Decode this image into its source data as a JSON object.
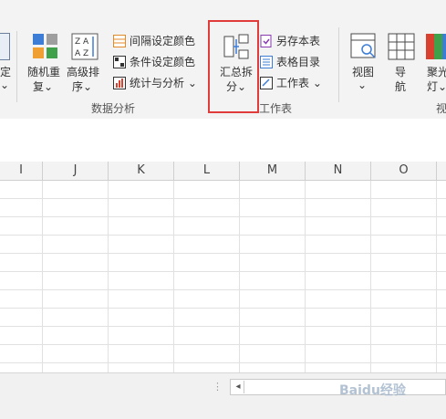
{
  "ribbon": {
    "left_clip": {
      "line1": "定",
      "line2": "⌄"
    },
    "random_btn": {
      "line1": "随机重",
      "line2": "复⌄"
    },
    "sort_btn": {
      "line1": "高级排",
      "line2": "序⌄"
    },
    "list": [
      {
        "label": "间隔设定颜色"
      },
      {
        "label": "条件设定颜色"
      },
      {
        "label": "统计与分析 ⌄"
      }
    ],
    "group_data_analysis": "数据分析",
    "summary_split": {
      "line1": "汇总拆",
      "line2": "分⌄"
    },
    "worksheet_list": [
      {
        "label": "另存本表"
      },
      {
        "label": "表格目录"
      },
      {
        "label": "工作表 ⌄"
      }
    ],
    "group_worksheet": "工作表",
    "view_btn": {
      "line1": "视图",
      "line2": "⌄"
    },
    "nav_btn": {
      "line1": "导",
      "line2": "航"
    },
    "spotlight_btn": {
      "line1": "聚光",
      "line2": "灯⌄"
    },
    "group_view_clip": "视"
  },
  "columns": [
    "I",
    "J",
    "K",
    "L",
    "M",
    "N",
    "O"
  ],
  "status": {
    "scroll_left": "◂"
  },
  "watermark": "Baidu经验"
}
